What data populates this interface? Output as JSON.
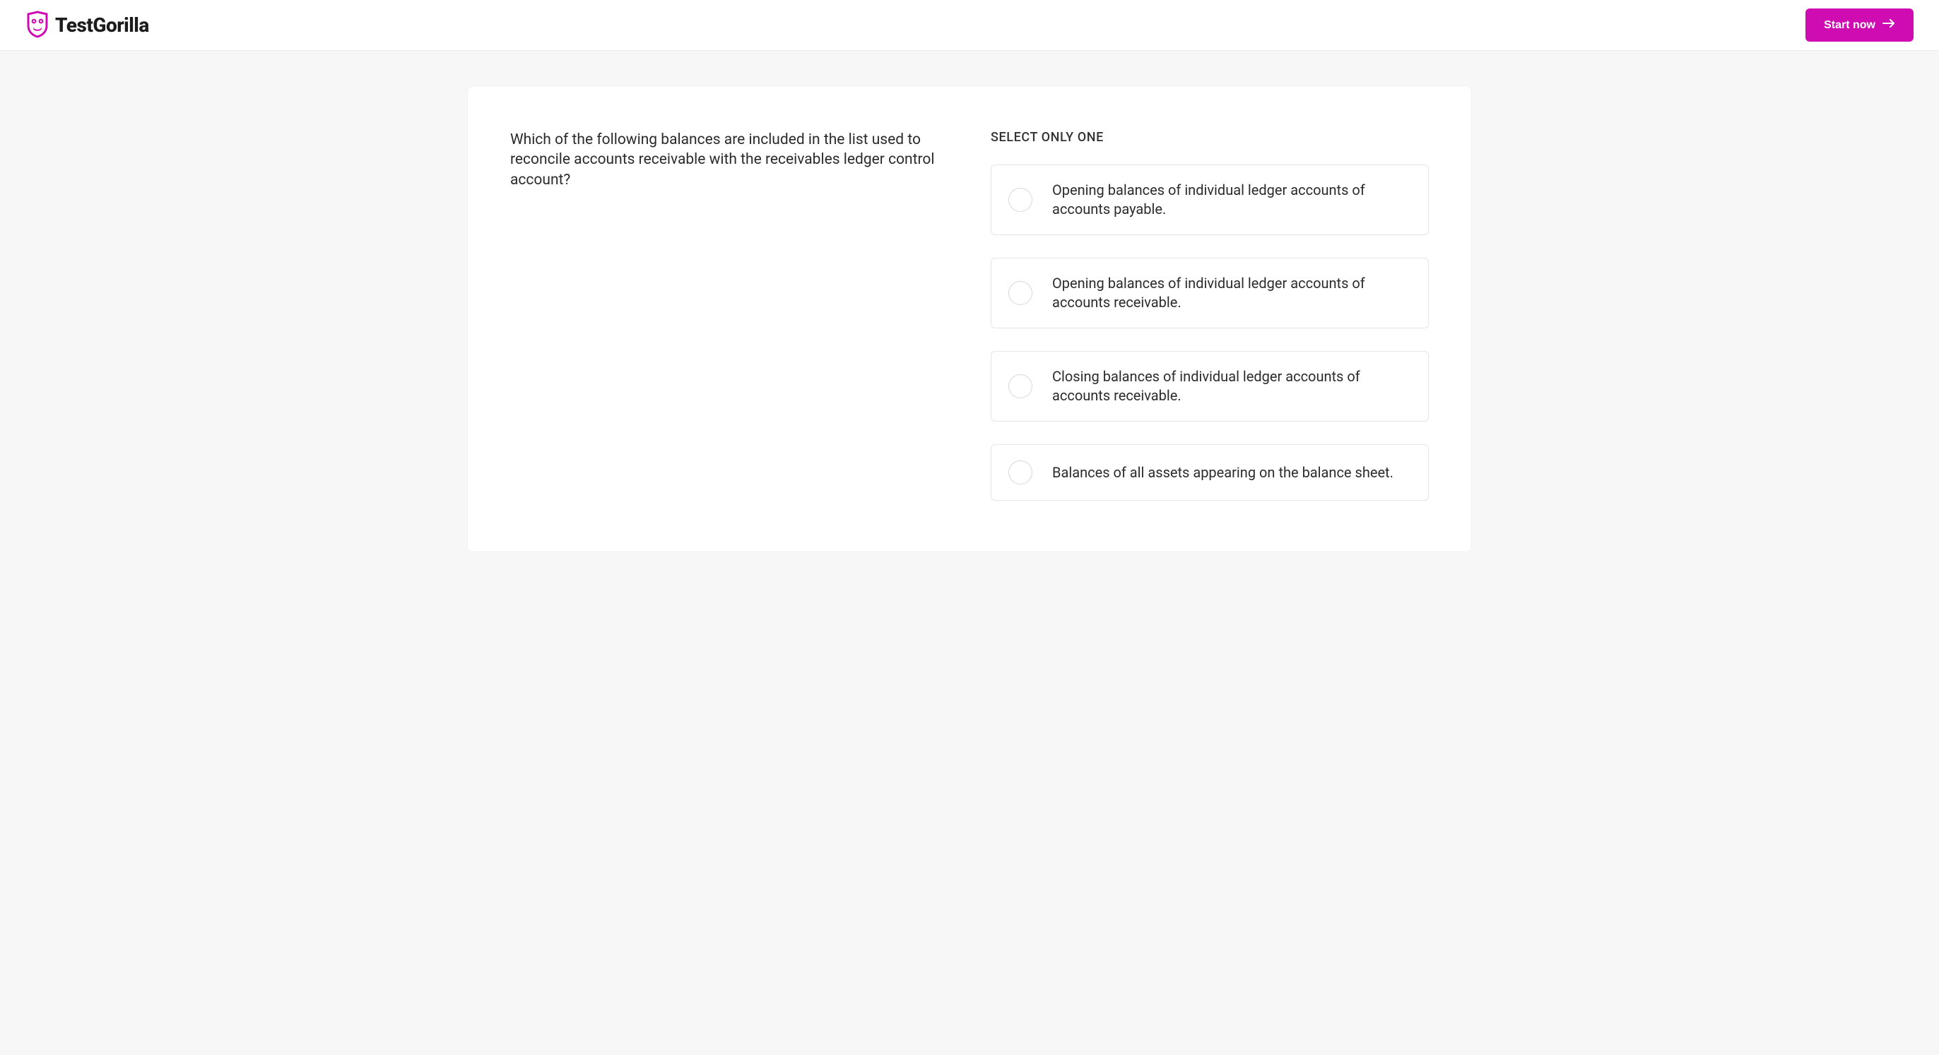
{
  "header": {
    "brand": "TestGorilla",
    "start_label": "Start now"
  },
  "question": {
    "prompt": "Which of the following balances are included in the list used to reconcile accounts receivable with the receivables ledger control account?"
  },
  "answers": {
    "instruction": "SELECT ONLY ONE",
    "options": [
      "Opening balances of individual ledger accounts of accounts payable.",
      "Opening balances of individual ledger accounts of accounts receivable.",
      "Closing balances of individual ledger accounts of accounts receivable.",
      "Balances of all assets appearing on the balance sheet."
    ]
  }
}
